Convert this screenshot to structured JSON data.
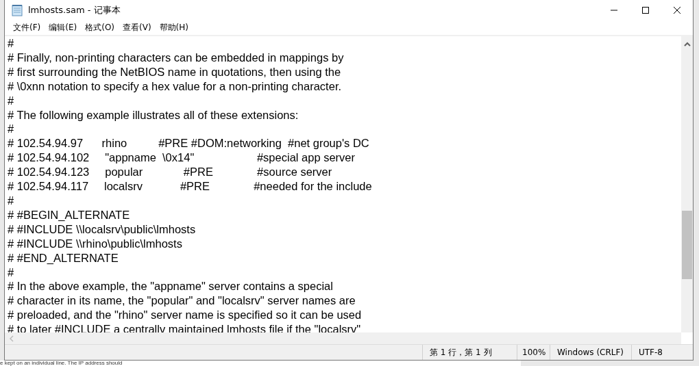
{
  "window": {
    "title": "lmhosts.sam - 记事本"
  },
  "menu": [
    "文件(F)",
    "编辑(E)",
    "格式(O)",
    "查看(V)",
    "帮助(H)"
  ],
  "lines": [
    "#",
    "# Finally, non-printing characters can be embedded in mappings by",
    "# first surrounding the NetBIOS name in quotations, then using the",
    "# \\0xnn notation to specify a hex value for a non-printing character.",
    "#",
    "# The following example illustrates all of these extensions:",
    "#",
    "# 102.54.94.97      rhino          #PRE #DOM:networking  #net group's DC",
    "# 102.54.94.102     \"appname  \\0x14\"                    #special app server",
    "# 102.54.94.123     popular             #PRE              #source server",
    "# 102.54.94.117     localsrv            #PRE              #needed for the include",
    "#",
    "# #BEGIN_ALTERNATE",
    "# #INCLUDE \\\\localsrv\\public\\lmhosts",
    "# #INCLUDE \\\\rhino\\public\\lmhosts",
    "# #END_ALTERNATE",
    "#",
    "# In the above example, the \"appname\" server contains a special",
    "# character in its name, the \"popular\" and \"localsrv\" server names are",
    "# preloaded, and the \"rhino\" server name is specified so it can be used",
    "# to later #INCLUDE a centrallv maintained lmhosts file if the \"localsrv\""
  ],
  "status_bar": {
    "position": "第 1 行，第 1 列",
    "zoom": "100%",
    "line_ending": "Windows (CRLF)",
    "encoding": "UTF-8"
  },
  "background_text": "e kept on an individual line. The IP address should"
}
